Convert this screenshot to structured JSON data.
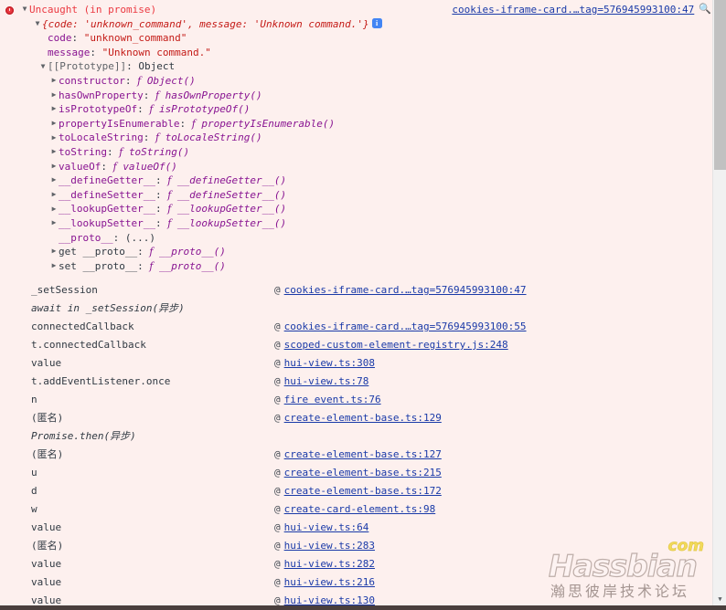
{
  "error": {
    "icon": "error-circle-icon",
    "title": "Uncaught (in promise)",
    "preview": "{code: 'unknown_command', message: 'Unknown command.'}",
    "info_icon": "info-icon",
    "source_link": "cookies-iframe-card.…tag=576945993100:47",
    "search_icon": "magnifier-icon",
    "properties": [
      {
        "name": "code",
        "separator": ": ",
        "value": "\"unknown_command\"",
        "kind": "string",
        "expandable": false
      },
      {
        "name": "message",
        "separator": ": ",
        "value": "\"Unknown command.\"",
        "kind": "string",
        "expandable": false
      }
    ],
    "prototype": {
      "label": "[[Prototype]]",
      "separator": ": ",
      "value": "Object",
      "members": [
        {
          "name": "constructor",
          "fn": "Object()",
          "expandable": true
        },
        {
          "name": "hasOwnProperty",
          "fn": "hasOwnProperty()",
          "expandable": true
        },
        {
          "name": "isPrototypeOf",
          "fn": "isPrototypeOf()",
          "expandable": true
        },
        {
          "name": "propertyIsEnumerable",
          "fn": "propertyIsEnumerable()",
          "expandable": true
        },
        {
          "name": "toLocaleString",
          "fn": "toLocaleString()",
          "expandable": true
        },
        {
          "name": "toString",
          "fn": "toString()",
          "expandable": true
        },
        {
          "name": "valueOf",
          "fn": "valueOf()",
          "expandable": true
        },
        {
          "name": "__defineGetter__",
          "fn": "__defineGetter__()",
          "expandable": true
        },
        {
          "name": "__defineSetter__",
          "fn": "__defineSetter__()",
          "expandable": true
        },
        {
          "name": "__lookupGetter__",
          "fn": "__lookupGetter__()",
          "expandable": true
        },
        {
          "name": "__lookupSetter__",
          "fn": "__lookupSetter__()",
          "expandable": true
        },
        {
          "name": "__proto__",
          "fn": "(...)",
          "plain": true,
          "expandable": false
        },
        {
          "name": "get __proto__",
          "fn": "__proto__()",
          "expandable": true
        },
        {
          "name": "set __proto__",
          "fn": "__proto__()",
          "expandable": true
        }
      ]
    }
  },
  "stack_frames": [
    {
      "fn": "_setSession",
      "async": false,
      "at": "@",
      "link": "cookies-iframe-card.…tag=576945993100:47"
    },
    {
      "fn": "await in _setSession(异步)",
      "async": true,
      "at": "",
      "link": ""
    },
    {
      "fn": "connectedCallback",
      "async": false,
      "at": "@",
      "link": "cookies-iframe-card.…tag=576945993100:55"
    },
    {
      "fn": "t.connectedCallback",
      "async": false,
      "at": "@",
      "link": "scoped-custom-element-registry.js:248"
    },
    {
      "fn": "value",
      "async": false,
      "at": "@",
      "link": "hui-view.ts:308"
    },
    {
      "fn": "t.addEventListener.once",
      "async": false,
      "at": "@",
      "link": "hui-view.ts:78"
    },
    {
      "fn": "n",
      "async": false,
      "at": "@",
      "link": "fire event.ts:76"
    },
    {
      "fn": "(匿名)",
      "async": false,
      "at": "@",
      "link": "create-element-base.ts:129"
    },
    {
      "fn": "Promise.then(异步)",
      "async": true,
      "at": "",
      "link": ""
    },
    {
      "fn": "(匿名)",
      "async": false,
      "at": "@",
      "link": "create-element-base.ts:127"
    },
    {
      "fn": "u",
      "async": false,
      "at": "@",
      "link": "create-element-base.ts:215"
    },
    {
      "fn": "d",
      "async": false,
      "at": "@",
      "link": "create-element-base.ts:172"
    },
    {
      "fn": "w",
      "async": false,
      "at": "@",
      "link": "create-card-element.ts:98"
    },
    {
      "fn": "value",
      "async": false,
      "at": "@",
      "link": "hui-view.ts:64"
    },
    {
      "fn": "(匿名)",
      "async": false,
      "at": "@",
      "link": "hui-view.ts:283"
    },
    {
      "fn": "value",
      "async": false,
      "at": "@",
      "link": "hui-view.ts:282"
    },
    {
      "fn": "value",
      "async": false,
      "at": "@",
      "link": "hui-view.ts:216"
    },
    {
      "fn": "value",
      "async": false,
      "at": "@",
      "link": "hui-view.ts:130"
    }
  ],
  "watermark": {
    "brand": "Hassbian",
    "tld": "com",
    "subtitle": "瀚思彼岸技术论坛"
  },
  "scrollbar": {
    "down_arrow": "▼"
  },
  "colors": {
    "background": "#fdf0ee",
    "error_text": "#eb3941",
    "string_value": "#c41a16",
    "property_name": "#881391",
    "link": "#1a3aa8",
    "info_badge": "#4285f4"
  }
}
